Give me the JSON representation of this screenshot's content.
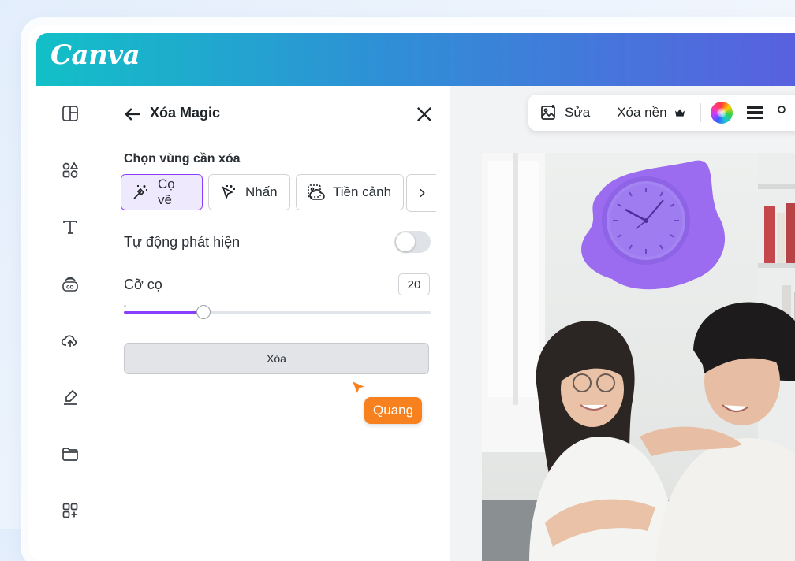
{
  "app": {
    "logo_text": "Canva"
  },
  "rail": {
    "items": [
      {
        "icon": "layout-template-icon"
      },
      {
        "icon": "elements-shapes-icon"
      },
      {
        "icon": "text-icon"
      },
      {
        "icon": "brand-co-icon"
      },
      {
        "icon": "upload-cloud-icon"
      },
      {
        "icon": "draw-pen-icon"
      },
      {
        "icon": "folder-projects-icon"
      },
      {
        "icon": "apps-grid-icon"
      }
    ]
  },
  "panel": {
    "title": "Xóa Magic",
    "section_label": "Chọn vùng cần xóa",
    "modes": [
      {
        "label": "Cọ vẽ",
        "icon": "magic-brush-icon",
        "active": true
      },
      {
        "label": "Nhấn",
        "icon": "magic-click-icon",
        "active": false
      },
      {
        "label": "Tiền cảnh",
        "icon": "foreground-image-icon",
        "active": false
      }
    ],
    "auto_detect_label": "Tự động phát hiện",
    "auto_detect_on": false,
    "brush_size_label": "Cỡ cọ",
    "brush_size_value": "20",
    "brush_size_fraction": 0.26,
    "erase_button_label": "Xóa"
  },
  "collaborator": {
    "name": "Quang",
    "color": "#f7811f"
  },
  "toolbar": {
    "edit_label": "Sửa",
    "remove_bg_label": "Xóa nền"
  },
  "colors": {
    "accent_purple": "#8b3dff",
    "gradient_start": "#12c0c7",
    "gradient_end": "#5b5ee0",
    "brush_mask": "#9b6bf0"
  }
}
